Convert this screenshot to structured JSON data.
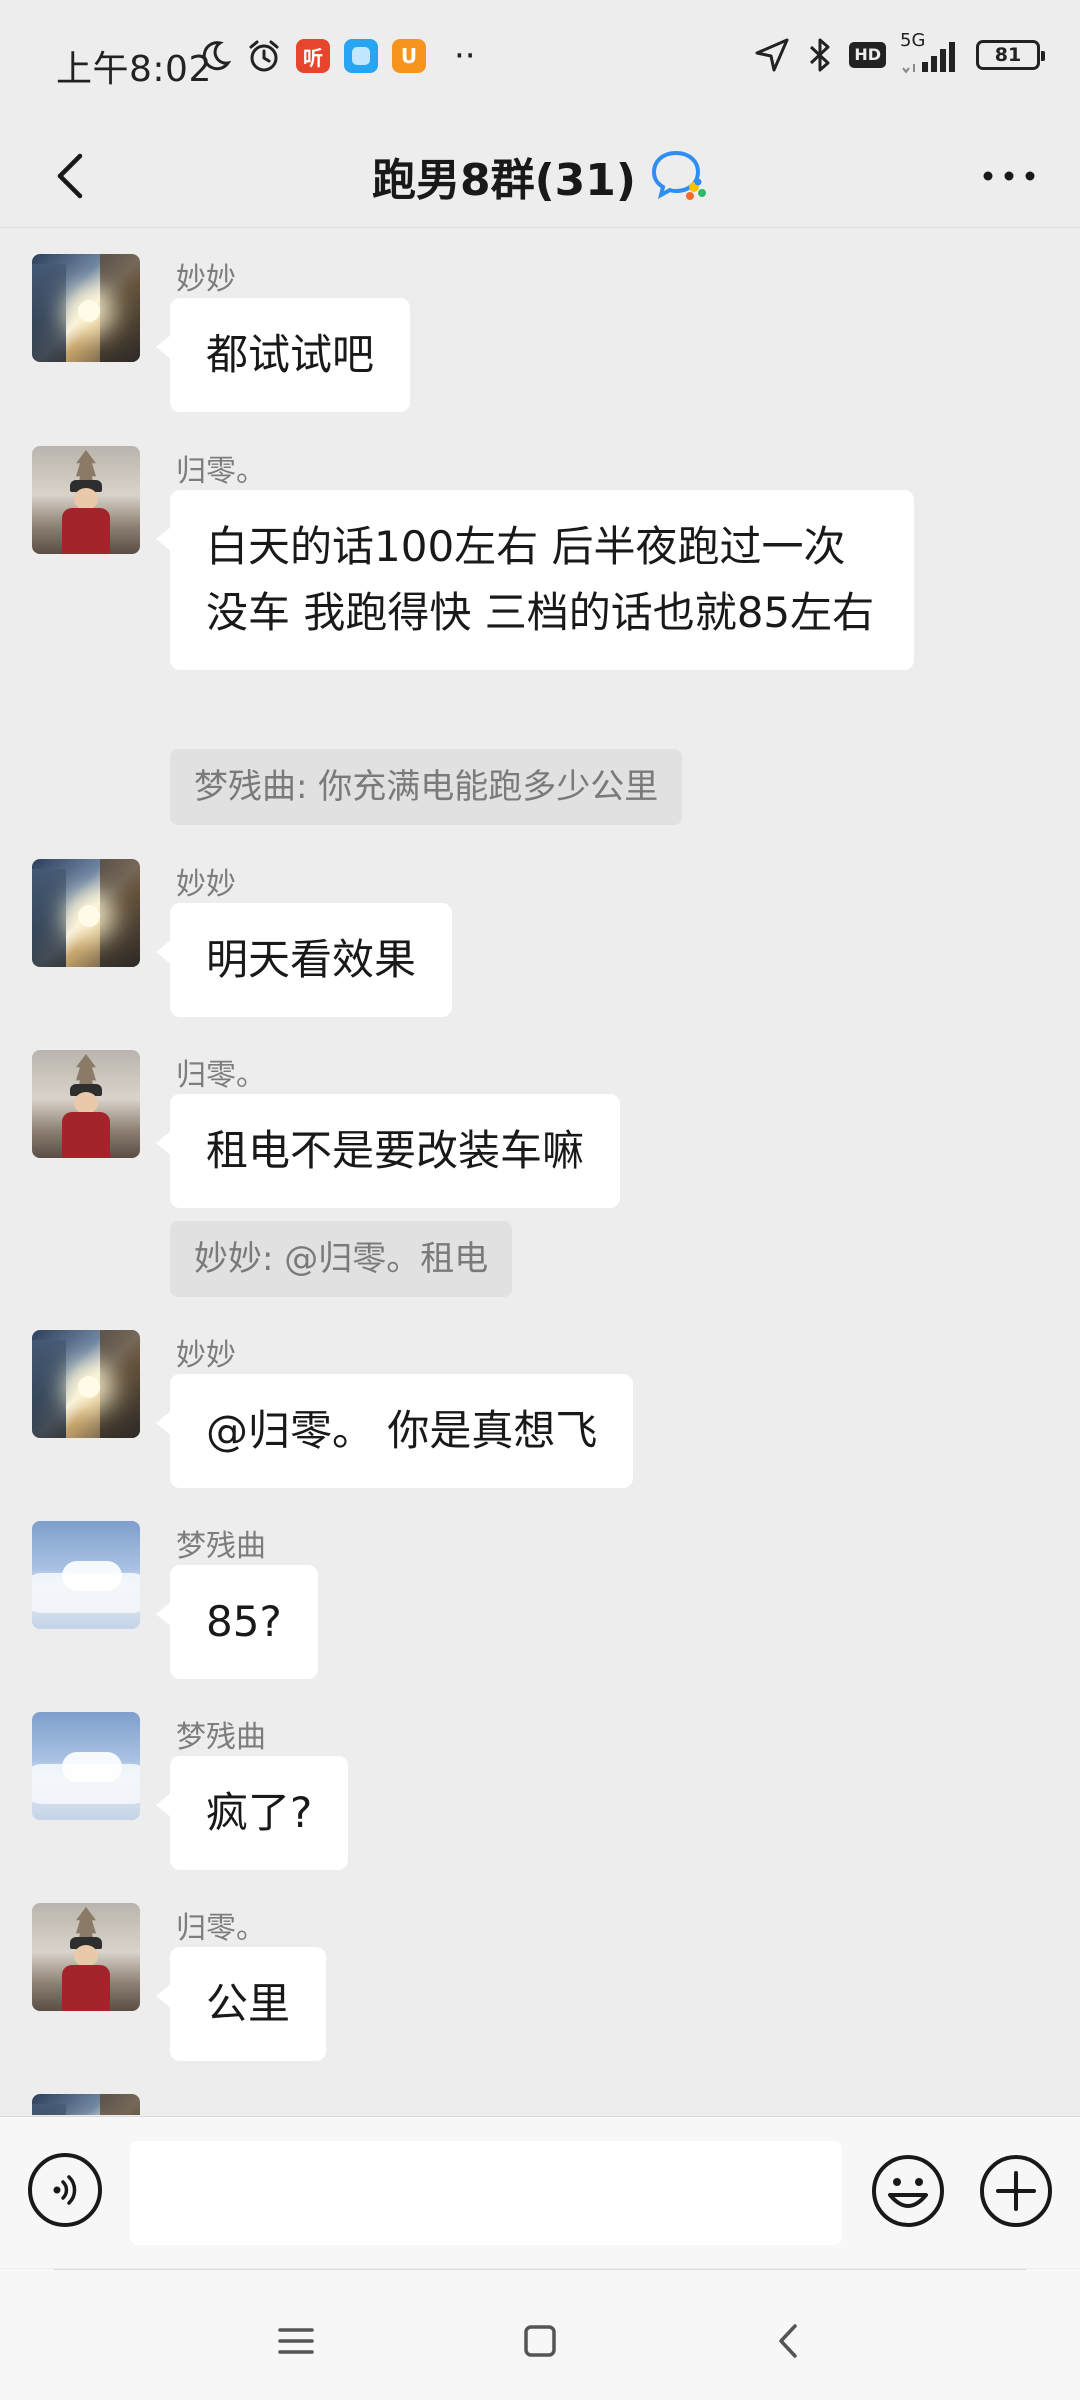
{
  "status_bar": {
    "time": "上午8:02",
    "apps": [
      {
        "name": "ting",
        "label": "听",
        "color": "#e8452f"
      },
      {
        "name": "blue-app",
        "label": "",
        "color": "#27a5f2"
      },
      {
        "name": "u-app",
        "label": "U",
        "color": "#f7941d"
      }
    ],
    "more_dots": "··",
    "hd": "HD",
    "network": "5G",
    "battery": "81"
  },
  "nav": {
    "title": "跑男8群(31)"
  },
  "messages": [
    {
      "sender": "妙妙",
      "text": "都试试吧",
      "avatar": "city"
    },
    {
      "sender": "归零。",
      "text": "白天的话100左右 后半夜跑过一次 没车 我跑得快 三档的话也就85左右",
      "avatar": "tower",
      "quote": "梦残曲: 你充满电能跑多少公里"
    },
    {
      "sender": "妙妙",
      "text": "明天看效果",
      "avatar": "city"
    },
    {
      "sender": "归零。",
      "text": "租电不是要改装车嘛",
      "avatar": "tower",
      "quote": "妙妙: @归零。租电"
    },
    {
      "sender": "妙妙",
      "text": "@归零。 你是真想飞",
      "avatar": "city"
    },
    {
      "sender": "梦残曲",
      "text": "85?",
      "avatar": "sky"
    },
    {
      "sender": "梦残曲",
      "text": "疯了?",
      "avatar": "sky"
    },
    {
      "sender": "归零。",
      "text": "公里",
      "avatar": "tower"
    }
  ],
  "input": {
    "value": "",
    "placeholder": ""
  },
  "colors": {
    "background": "#ededed",
    "bubble": "#ffffff",
    "quote_bg": "#e1e1e1",
    "sender": "#7d7d7d"
  }
}
